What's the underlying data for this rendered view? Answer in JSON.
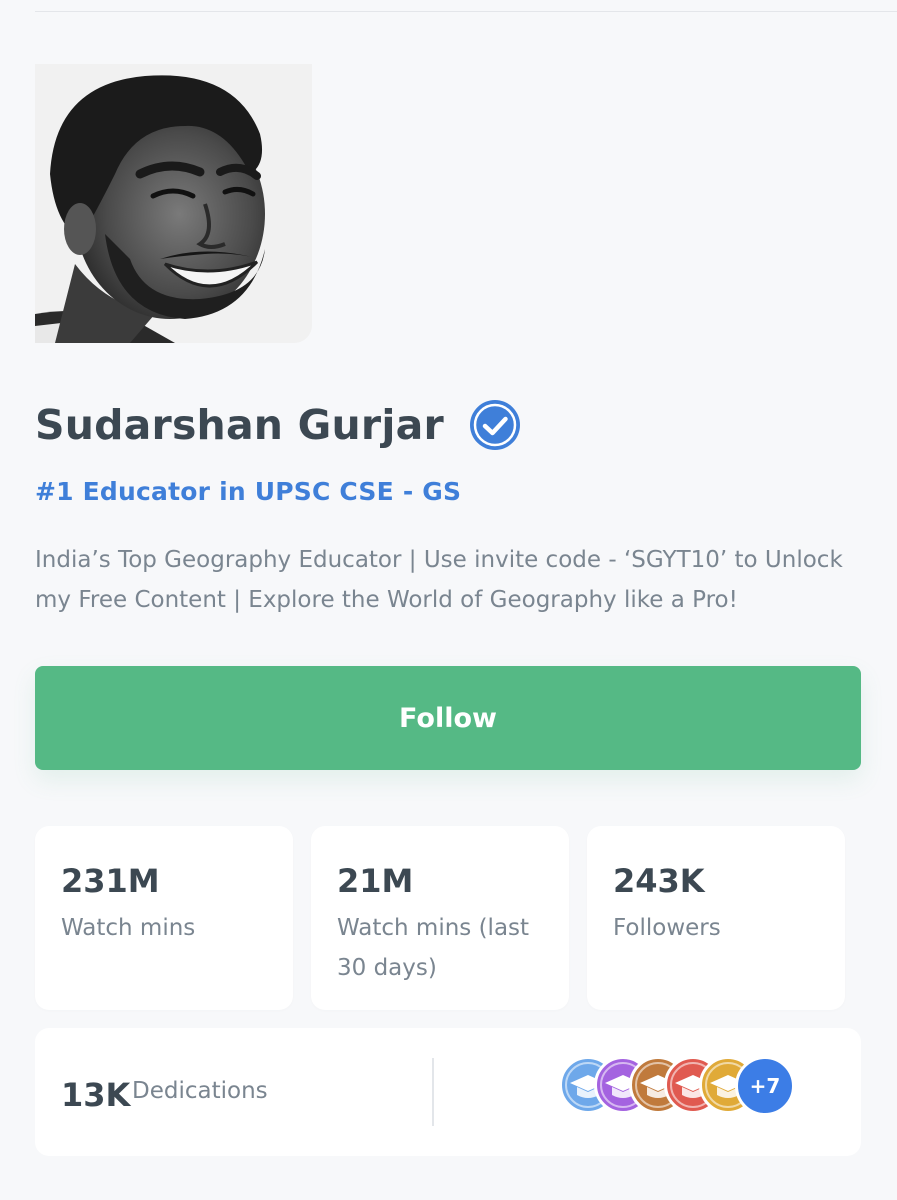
{
  "profile": {
    "name": "Sudarshan Gurjar",
    "verified": true,
    "verified_icon": "verified-check-icon",
    "headline": "#1 Educator in UPSC CSE - GS",
    "bio": "India’s Top Geography Educator | Use invite code - ‘SGYT10’ to Unlock my Free Content | Explore the World of Geography like a Pro!",
    "follow_label": "Follow"
  },
  "stats": [
    {
      "value": "231M",
      "label": "Watch mins"
    },
    {
      "value": "21M",
      "label": "Watch mins (last 30 days)"
    },
    {
      "value": "243K",
      "label": "Followers"
    }
  ],
  "dedications": {
    "value": "13K",
    "label": "Dedications",
    "badges": [
      {
        "icon": "graduation-cap-badge-icon",
        "color": "#6ea8ea"
      },
      {
        "icon": "graduation-cap-badge-icon",
        "color": "#a463e0"
      },
      {
        "icon": "graduation-cap-badge-icon",
        "color": "#c07a3c"
      },
      {
        "icon": "graduation-cap-badge-icon",
        "color": "#e05a50"
      },
      {
        "icon": "graduation-cap-badge-icon",
        "color": "#e0aa38"
      }
    ],
    "more_count": "+7"
  },
  "colors": {
    "accent_blue": "#3f7fd9",
    "follow_green": "#55b985",
    "text_dark": "#3c4852",
    "text_muted": "#7a8590",
    "background": "#f7f8fa"
  }
}
